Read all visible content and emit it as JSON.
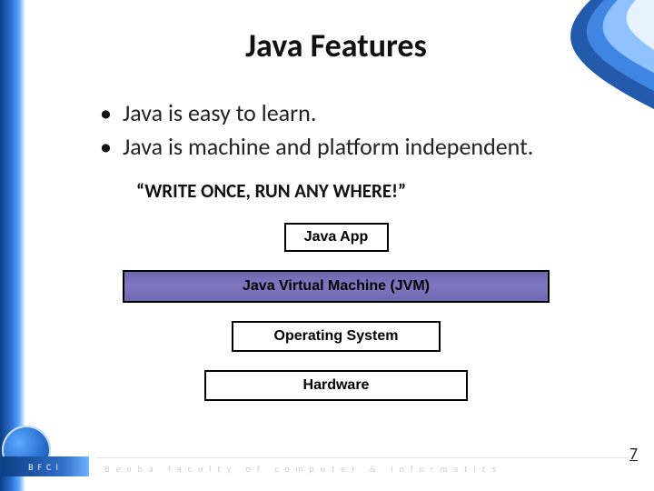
{
  "title": "Java Features",
  "bullets": [
    "Java is easy to learn.",
    "Java is machine and platform independent."
  ],
  "slogan": "“WRITE ONCE, RUN ANY WHERE!”",
  "stack": {
    "app": "Java App",
    "jvm": "Java Virtual Machine (JVM)",
    "os": "Operating System",
    "hw": "Hardware"
  },
  "footer": {
    "acronym": "BFCI",
    "text": "Benha faculty of computer & Informatics"
  },
  "page_number": "7"
}
